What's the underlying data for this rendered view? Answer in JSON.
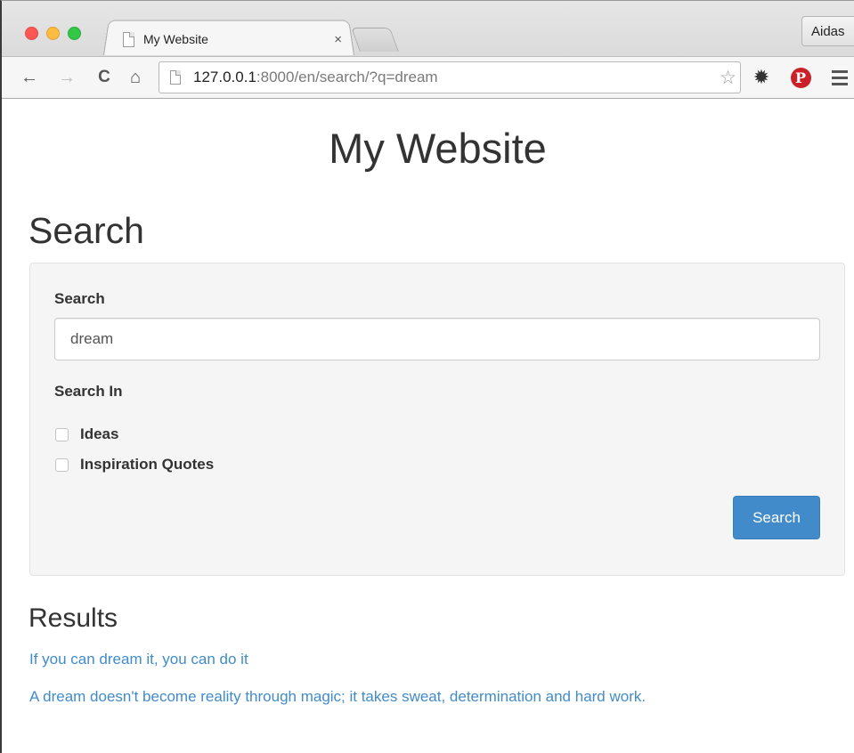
{
  "browser": {
    "tab_title": "My Website",
    "tab_close": "×",
    "profile_name": "Aidas",
    "url_host": "127.0.0.1",
    "url_path": ":8000/en/search/?q=dream",
    "icons": {
      "back": "←",
      "forward": "→",
      "reload": "C",
      "home": "⌂",
      "star": "☆",
      "gear": "✹",
      "pinterest": "P"
    }
  },
  "page": {
    "site_title": "My Website",
    "heading": "Search",
    "form": {
      "search_label": "Search",
      "search_value": "dream",
      "search_in_label": "Search In",
      "options": [
        {
          "label": "Ideas",
          "checked": false
        },
        {
          "label": "Inspiration Quotes",
          "checked": false
        }
      ],
      "submit_label": "Search"
    },
    "results": {
      "heading": "Results",
      "items": [
        "If you can dream it, you can do it",
        "A dream doesn't become reality through magic; it takes sweat, determination and hard work."
      ]
    }
  },
  "colors": {
    "link": "#428bca",
    "primary_button": "#428bca",
    "pinterest": "#cb2027"
  }
}
